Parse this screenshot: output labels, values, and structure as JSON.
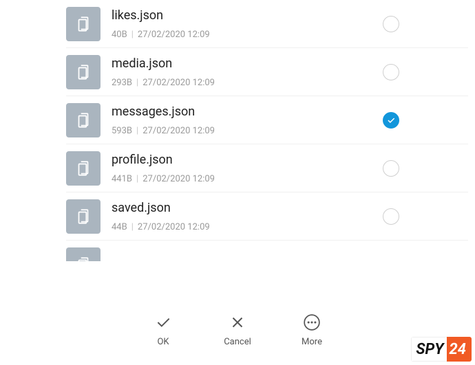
{
  "files": [
    {
      "name": "likes.json",
      "size": "40B",
      "date": "27/02/2020 12:09",
      "checked": false
    },
    {
      "name": "media.json",
      "size": "293B",
      "date": "27/02/2020 12:09",
      "checked": false
    },
    {
      "name": "messages.json",
      "size": "593B",
      "date": "27/02/2020 12:09",
      "checked": true
    },
    {
      "name": "profile.json",
      "size": "441B",
      "date": "27/02/2020 12:09",
      "checked": false
    },
    {
      "name": "saved.json",
      "size": "44B",
      "date": "27/02/2020 12:09",
      "checked": false
    }
  ],
  "bottombar": {
    "ok": "OK",
    "cancel": "Cancel",
    "more": "More"
  },
  "watermark": {
    "left": "SPY",
    "right": "24"
  }
}
